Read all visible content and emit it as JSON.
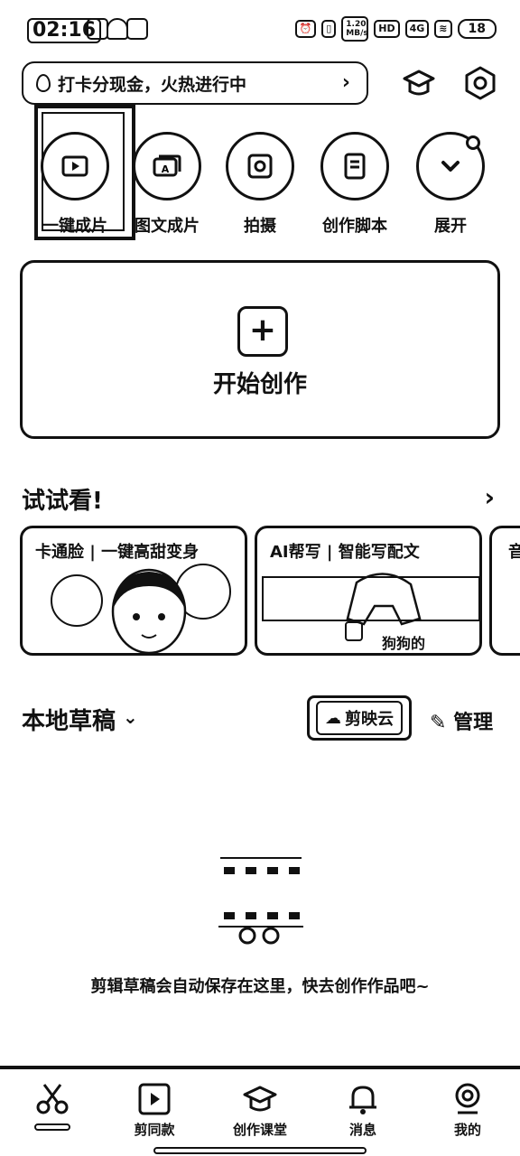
{
  "status_bar": {
    "time": "02:16",
    "net_speed": "1.20 MB/s",
    "hd": "HD",
    "network": "4G",
    "battery": "18"
  },
  "banner": {
    "text": "打卡分现金，火热进行中",
    "chevron": "›"
  },
  "top_icons": [
    "graduation-cap-icon",
    "settings-hexagon-icon"
  ],
  "shortcuts": [
    {
      "label": "一键成片",
      "icon": "video-play-icon"
    },
    {
      "label": "图文成片",
      "icon": "image-text-icon"
    },
    {
      "label": "拍摄",
      "icon": "camera-icon"
    },
    {
      "label": "创作脚本",
      "icon": "script-icon"
    },
    {
      "label": "展开",
      "icon": "chevron-down-icon"
    }
  ],
  "create_card": {
    "plus": "+",
    "title": "开始创作"
  },
  "try_section": {
    "title": "试试看!",
    "cards": [
      {
        "caption": "卡通脸 | 一键高甜变身"
      },
      {
        "caption": "AI帮写 | 智能写配文",
        "sub": "狗狗的"
      },
      {
        "caption": "音"
      }
    ]
  },
  "drafts": {
    "title": "本地草稿",
    "cloud_label": "剪映云",
    "manage_label": "管理",
    "empty_text": "剪辑草稿会自动保存在这里，快去创作作品吧~"
  },
  "bottom_nav": [
    {
      "label": "",
      "icon": "scissors-icon",
      "active": true
    },
    {
      "label": "剪同款",
      "icon": "template-film-icon"
    },
    {
      "label": "创作课堂",
      "icon": "graduation-cap-icon"
    },
    {
      "label": "消息",
      "icon": "bell-icon"
    },
    {
      "label": "我的",
      "icon": "profile-icon"
    }
  ]
}
